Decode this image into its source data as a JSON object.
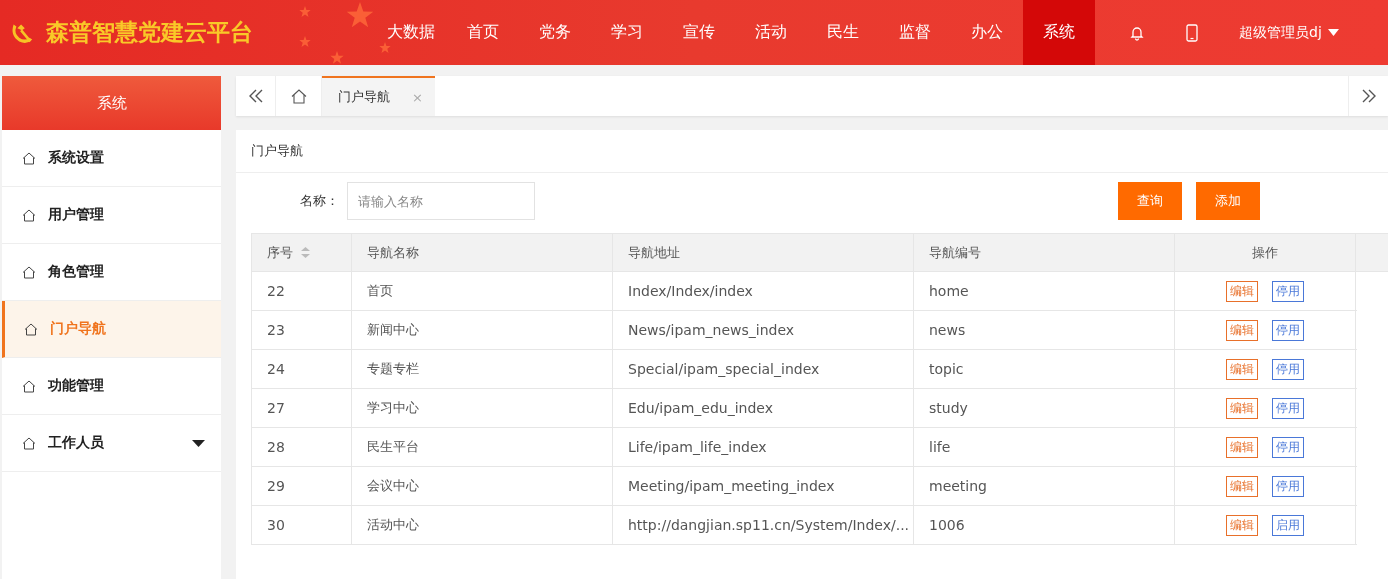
{
  "header": {
    "logo_text": "森普智慧党建云平台",
    "nav": [
      {
        "label": "大数据",
        "selected": false
      },
      {
        "label": "首页",
        "selected": false
      },
      {
        "label": "党务",
        "selected": false
      },
      {
        "label": "学习",
        "selected": false
      },
      {
        "label": "宣传",
        "selected": false
      },
      {
        "label": "活动",
        "selected": false
      },
      {
        "label": "民生",
        "selected": false
      },
      {
        "label": "监督",
        "selected": false
      },
      {
        "label": "办公",
        "selected": false
      },
      {
        "label": "系统",
        "selected": true
      }
    ],
    "user": "超级管理员dj"
  },
  "sidebar": {
    "title": "系统",
    "items": [
      {
        "label": "系统设置",
        "selected": false,
        "expandable": false
      },
      {
        "label": "用户管理",
        "selected": false,
        "expandable": false
      },
      {
        "label": "角色管理",
        "selected": false,
        "expandable": false
      },
      {
        "label": "门户导航",
        "selected": true,
        "expandable": false
      },
      {
        "label": "功能管理",
        "selected": false,
        "expandable": false
      },
      {
        "label": "工作人员",
        "selected": false,
        "expandable": true
      }
    ]
  },
  "tabs": [
    {
      "label": "门户导航",
      "selected": true,
      "close": "×"
    }
  ],
  "panel": {
    "title": "门户导航",
    "search": {
      "label": "名称：",
      "placeholder": "请输入名称"
    },
    "buttons": [
      "查询",
      "添加"
    ]
  },
  "table": {
    "columns": [
      "序号",
      "导航名称",
      "导航地址",
      "导航编号",
      "操作"
    ],
    "rows": [
      {
        "id": "22",
        "name": "首页",
        "url": "Index/Index/index",
        "code": "home",
        "edit": "编辑",
        "toggle": "停用"
      },
      {
        "id": "23",
        "name": "新闻中心",
        "url": "News/ipam_news_index",
        "code": "news",
        "edit": "编辑",
        "toggle": "停用"
      },
      {
        "id": "24",
        "name": "专题专栏",
        "url": "Special/ipam_special_index",
        "code": "topic",
        "edit": "编辑",
        "toggle": "停用"
      },
      {
        "id": "27",
        "name": "学习中心",
        "url": "Edu/ipam_edu_index",
        "code": "study",
        "edit": "编辑",
        "toggle": "停用"
      },
      {
        "id": "28",
        "name": "民生平台",
        "url": "Life/ipam_life_index",
        "code": "life",
        "edit": "编辑",
        "toggle": "停用"
      },
      {
        "id": "29",
        "name": "会议中心",
        "url": "Meeting/ipam_meeting_index",
        "code": "meeting",
        "edit": "编辑",
        "toggle": "停用"
      },
      {
        "id": "30",
        "name": "活动中心",
        "url": "http://dangjian.sp11.cn/System/Index/...",
        "code": "1006",
        "edit": "编辑",
        "toggle": "启用"
      }
    ]
  }
}
